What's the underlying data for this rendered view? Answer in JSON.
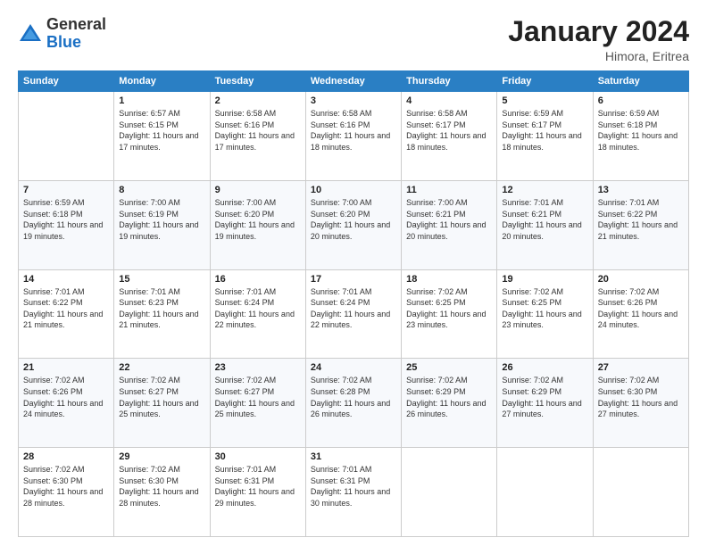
{
  "logo": {
    "general": "General",
    "blue": "Blue"
  },
  "header": {
    "month": "January 2024",
    "location": "Himora, Eritrea"
  },
  "weekdays": [
    "Sunday",
    "Monday",
    "Tuesday",
    "Wednesday",
    "Thursday",
    "Friday",
    "Saturday"
  ],
  "weeks": [
    [
      {
        "day": null
      },
      {
        "day": "1",
        "sunrise": "6:57 AM",
        "sunset": "6:15 PM",
        "daylight": "11 hours and 17 minutes."
      },
      {
        "day": "2",
        "sunrise": "6:58 AM",
        "sunset": "6:16 PM",
        "daylight": "11 hours and 17 minutes."
      },
      {
        "day": "3",
        "sunrise": "6:58 AM",
        "sunset": "6:16 PM",
        "daylight": "11 hours and 18 minutes."
      },
      {
        "day": "4",
        "sunrise": "6:58 AM",
        "sunset": "6:17 PM",
        "daylight": "11 hours and 18 minutes."
      },
      {
        "day": "5",
        "sunrise": "6:59 AM",
        "sunset": "6:17 PM",
        "daylight": "11 hours and 18 minutes."
      },
      {
        "day": "6",
        "sunrise": "6:59 AM",
        "sunset": "6:18 PM",
        "daylight": "11 hours and 18 minutes."
      }
    ],
    [
      {
        "day": "7",
        "sunrise": "6:59 AM",
        "sunset": "6:18 PM",
        "daylight": "11 hours and 19 minutes."
      },
      {
        "day": "8",
        "sunrise": "7:00 AM",
        "sunset": "6:19 PM",
        "daylight": "11 hours and 19 minutes."
      },
      {
        "day": "9",
        "sunrise": "7:00 AM",
        "sunset": "6:20 PM",
        "daylight": "11 hours and 19 minutes."
      },
      {
        "day": "10",
        "sunrise": "7:00 AM",
        "sunset": "6:20 PM",
        "daylight": "11 hours and 20 minutes."
      },
      {
        "day": "11",
        "sunrise": "7:00 AM",
        "sunset": "6:21 PM",
        "daylight": "11 hours and 20 minutes."
      },
      {
        "day": "12",
        "sunrise": "7:01 AM",
        "sunset": "6:21 PM",
        "daylight": "11 hours and 20 minutes."
      },
      {
        "day": "13",
        "sunrise": "7:01 AM",
        "sunset": "6:22 PM",
        "daylight": "11 hours and 21 minutes."
      }
    ],
    [
      {
        "day": "14",
        "sunrise": "7:01 AM",
        "sunset": "6:22 PM",
        "daylight": "11 hours and 21 minutes."
      },
      {
        "day": "15",
        "sunrise": "7:01 AM",
        "sunset": "6:23 PM",
        "daylight": "11 hours and 21 minutes."
      },
      {
        "day": "16",
        "sunrise": "7:01 AM",
        "sunset": "6:24 PM",
        "daylight": "11 hours and 22 minutes."
      },
      {
        "day": "17",
        "sunrise": "7:01 AM",
        "sunset": "6:24 PM",
        "daylight": "11 hours and 22 minutes."
      },
      {
        "day": "18",
        "sunrise": "7:02 AM",
        "sunset": "6:25 PM",
        "daylight": "11 hours and 23 minutes."
      },
      {
        "day": "19",
        "sunrise": "7:02 AM",
        "sunset": "6:25 PM",
        "daylight": "11 hours and 23 minutes."
      },
      {
        "day": "20",
        "sunrise": "7:02 AM",
        "sunset": "6:26 PM",
        "daylight": "11 hours and 24 minutes."
      }
    ],
    [
      {
        "day": "21",
        "sunrise": "7:02 AM",
        "sunset": "6:26 PM",
        "daylight": "11 hours and 24 minutes."
      },
      {
        "day": "22",
        "sunrise": "7:02 AM",
        "sunset": "6:27 PM",
        "daylight": "11 hours and 25 minutes."
      },
      {
        "day": "23",
        "sunrise": "7:02 AM",
        "sunset": "6:27 PM",
        "daylight": "11 hours and 25 minutes."
      },
      {
        "day": "24",
        "sunrise": "7:02 AM",
        "sunset": "6:28 PM",
        "daylight": "11 hours and 26 minutes."
      },
      {
        "day": "25",
        "sunrise": "7:02 AM",
        "sunset": "6:29 PM",
        "daylight": "11 hours and 26 minutes."
      },
      {
        "day": "26",
        "sunrise": "7:02 AM",
        "sunset": "6:29 PM",
        "daylight": "11 hours and 27 minutes."
      },
      {
        "day": "27",
        "sunrise": "7:02 AM",
        "sunset": "6:30 PM",
        "daylight": "11 hours and 27 minutes."
      }
    ],
    [
      {
        "day": "28",
        "sunrise": "7:02 AM",
        "sunset": "6:30 PM",
        "daylight": "11 hours and 28 minutes."
      },
      {
        "day": "29",
        "sunrise": "7:02 AM",
        "sunset": "6:30 PM",
        "daylight": "11 hours and 28 minutes."
      },
      {
        "day": "30",
        "sunrise": "7:01 AM",
        "sunset": "6:31 PM",
        "daylight": "11 hours and 29 minutes."
      },
      {
        "day": "31",
        "sunrise": "7:01 AM",
        "sunset": "6:31 PM",
        "daylight": "11 hours and 30 minutes."
      },
      {
        "day": null
      },
      {
        "day": null
      },
      {
        "day": null
      }
    ]
  ]
}
